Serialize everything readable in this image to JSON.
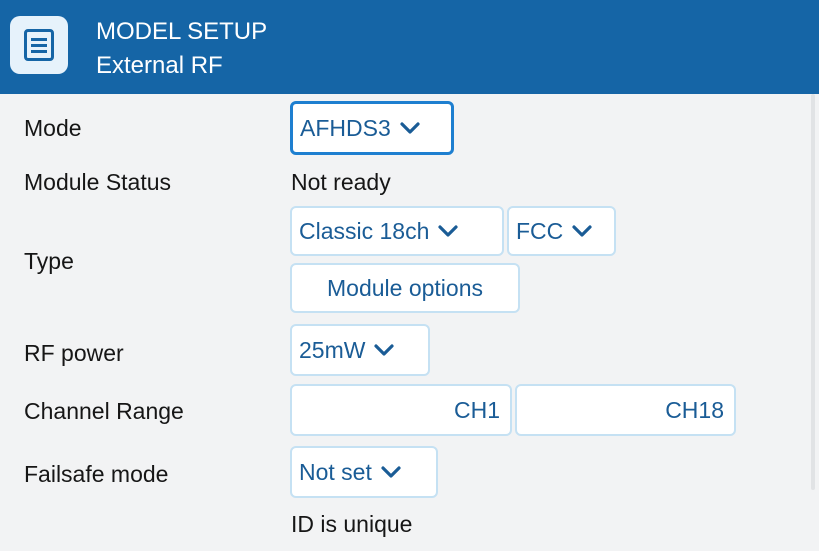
{
  "header": {
    "title": "MODEL SETUP",
    "subtitle": "External RF",
    "menu_icon": "menu-icon"
  },
  "rows": {
    "mode": {
      "label": "Mode",
      "value": "AFHDS3"
    },
    "module_status": {
      "label": "Module Status",
      "value": "Not ready"
    },
    "type": {
      "label": "Type",
      "protocol": "Classic 18ch",
      "region": "FCC",
      "options_button": "Module options"
    },
    "rf_power": {
      "label": "RF power",
      "value": "25mW"
    },
    "channel_range": {
      "label": "Channel Range",
      "start": "CH1",
      "end": "CH18"
    },
    "failsafe": {
      "label": "Failsafe mode",
      "value": "Not set"
    },
    "id_status": {
      "value": "ID is unique"
    }
  },
  "colors": {
    "header_bg": "#1565a6",
    "field_text": "#1a5c96",
    "field_border": "#c5e1f3",
    "focus_border": "#1e7fd0",
    "background": "#f2f3f4"
  }
}
